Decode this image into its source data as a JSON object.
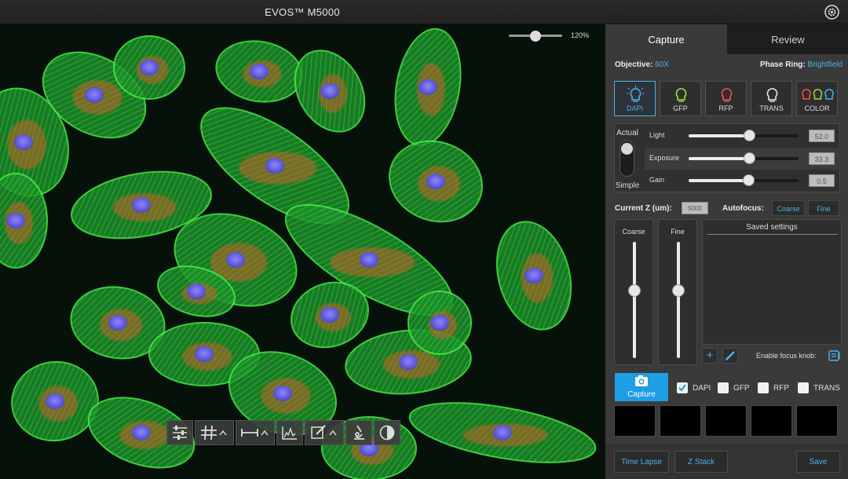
{
  "window": {
    "title": "EVOS™ M5000",
    "settings_icon": "gear-icon"
  },
  "viewer": {
    "zoom_label": "120%",
    "zoom_level_fraction": 0.4
  },
  "toolbar": {
    "buttons": [
      {
        "name": "adjust-sliders-icon"
      },
      {
        "name": "grid-icon",
        "menu": true
      },
      {
        "name": "measure-icon",
        "menu": true
      },
      {
        "name": "histogram-icon"
      },
      {
        "name": "annotate-icon",
        "menu": true
      },
      {
        "name": "microscope-icon"
      },
      {
        "name": "contrast-icon"
      }
    ]
  },
  "panel": {
    "tabs": [
      {
        "label": "Capture",
        "active": true
      },
      {
        "label": "Review",
        "active": false
      }
    ],
    "objective_label": "Objective:",
    "objective_value": "60X",
    "phase_ring_label": "Phase Ring:",
    "phase_ring_value": "Brightfield",
    "channels": [
      {
        "label": "DAPI",
        "color": "#4ab2ea",
        "active": true
      },
      {
        "label": "GFP",
        "color": "#9be13a",
        "active": false
      },
      {
        "label": "RFP",
        "color": "#ff4a4a",
        "active": false
      },
      {
        "label": "TRANS",
        "color": "#e8e8e8",
        "active": false
      },
      {
        "label": "COLOR",
        "color": "#ff4a4a",
        "active": false
      }
    ],
    "mode_actual": "Actual",
    "mode_simple": "Simple",
    "light": {
      "label": "Light",
      "value": "52.0",
      "level": 0.56
    },
    "exposure": {
      "label": "Exposure",
      "value": "33.3",
      "level": 0.56
    },
    "gain": {
      "label": "Gain",
      "value": "0.5",
      "level": 0.55
    },
    "current_z_label": "Current Z (um):",
    "current_z_value": "5000",
    "autofocus_label": "Autofocus:",
    "autofocus_coarse": "Coarse",
    "autofocus_fine": "Fine",
    "coarse_label": "Coarse",
    "fine_label": "Fine",
    "saved_settings_title": "Saved settings",
    "enable_focus_knob_label": "Enable focus knob:",
    "capture_label": "Capture",
    "capture_channels": [
      {
        "label": "DAPI",
        "checked": true
      },
      {
        "label": "GFP",
        "checked": false
      },
      {
        "label": "RFP",
        "checked": false
      },
      {
        "label": "TRANS",
        "checked": false
      }
    ],
    "time_lapse_label": "Time Lapse",
    "z_stack_label": "Z Stack",
    "save_label": "Save"
  },
  "colors": {
    "accent": "#4ab2ea",
    "capture_button": "#1e9ee3",
    "cell_green": "#33d23a",
    "nucleus": "#6a63e6"
  }
}
